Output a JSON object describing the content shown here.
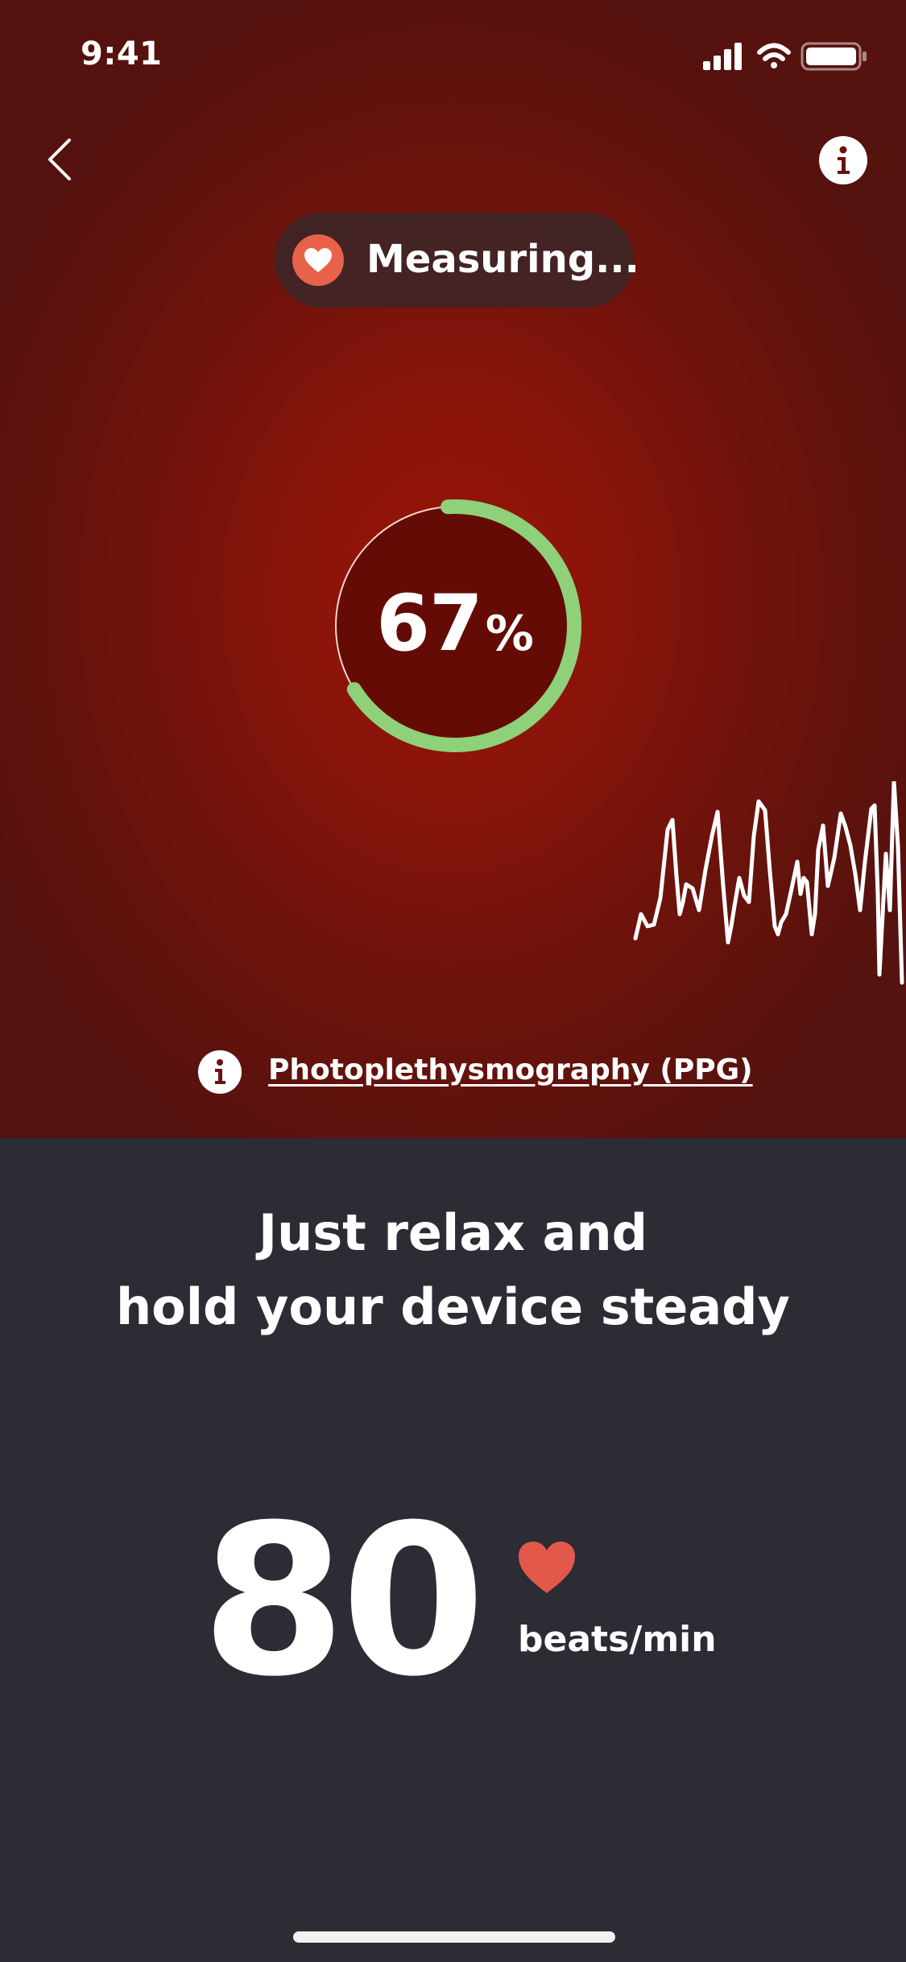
{
  "status_bar": {
    "time": "9:41",
    "icons": [
      "cellular-signal-icon",
      "wifi-icon",
      "battery-icon"
    ]
  },
  "nav": {
    "back_icon": "chevron-left-icon",
    "info_icon": "info-icon"
  },
  "status_pill": {
    "label": "Measuring...",
    "icon": "heart-icon",
    "icon_color": "#e8624a"
  },
  "progress": {
    "value": "67",
    "unit": "%",
    "fraction": 0.67,
    "color": "#8fd178"
  },
  "ppg": {
    "icon": "info-icon",
    "link_label": "Photoplethysmography (PPG)"
  },
  "instruction": {
    "line1": "Just relax and",
    "line2": "hold your device steady"
  },
  "heart_rate": {
    "value": "80",
    "unit": "beats/min",
    "icon": "heart-icon",
    "icon_color": "#e2584a"
  },
  "colors": {
    "top_background": "#8a140a",
    "bottom_background": "#2b2c34",
    "accent_green": "#8fd178"
  }
}
